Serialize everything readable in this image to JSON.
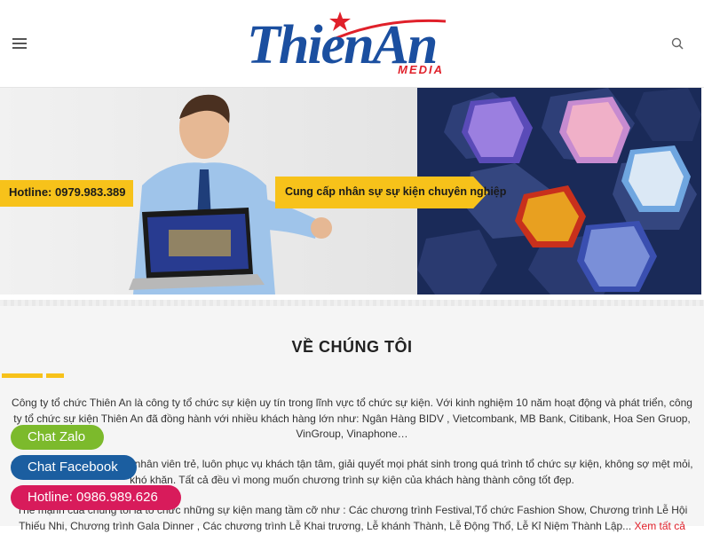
{
  "header": {
    "logo_main": "ThienAn",
    "logo_sub": "MEDIA",
    "menu_icon": "hamburger-icon",
    "search_icon": "search-icon"
  },
  "banner": {
    "hotline": "Hotline: 0979.983.389",
    "slogan": "Cung cấp nhân sự sự kiện chuyên nghiệp"
  },
  "about": {
    "title": "VỀ CHÚNG TÔI",
    "paragraph1": "Công ty tổ chức Thiên An là công ty tổ chức sự kiện uy tín trong lĩnh vực tổ chức sự kiện. Với kinh nghiệm 10 năm hoạt động và phát triển, công ty tổ chức sự kiện Thiên An đã đồng hành với nhiều khách hàng lớn như:  Ngân Hàng BIDV , Vietcombank, MB Bank, Citibank, Hoa Sen Gruop, VinGroup, Vinaphone…",
    "paragraph2": "Chúng tôi sở hữu đội ngũ nhân viên trẻ, luôn phục vụ khách tận tâm, giải quyết mọi phát sinh trong quá trình tổ chức sự kiện, không sợ mệt mỏi, khó khăn. Tất cả đều vì mong muốn chương trình sự kiện của khách hàng thành công tốt đẹp.",
    "paragraph3": "Thế mạnh của chúng tôi là tổ chức những sự kiện mang tầm cỡ  như : Các chương trình Festival,Tổ chức Fashion Show, Chương trình Lễ Hội Thiếu Nhi, Chương trình Gala Dinner , Các chương trình Lễ Khai trương, Lễ khánh Thành, Lễ Động Thổ, Lễ Kỉ Niệm Thành Lập...",
    "more_link": "Xem tất cả"
  },
  "floating_buttons": {
    "zalo": "Chat Zalo",
    "facebook": "Chat Facebook",
    "hotline": "Hotline: 0986.989.626"
  },
  "colors": {
    "brand_blue": "#1b4fa0",
    "brand_red": "#e0202a",
    "accent_yellow": "#f7c21a",
    "zalo_green": "#7cba2c",
    "facebook_blue": "#1b5ea0",
    "hotline_pink": "#d81b5b"
  }
}
